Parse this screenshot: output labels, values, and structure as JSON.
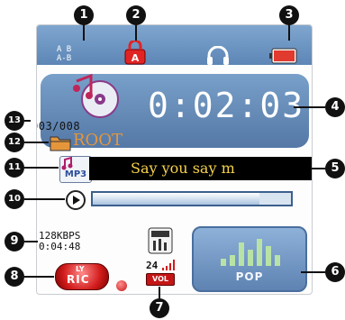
{
  "status_bar": {
    "ab_top": "A B",
    "ab_bottom": "A-B",
    "lock_label": "A"
  },
  "track": {
    "counter": "003/008",
    "folder": "ROOT",
    "lyric": "Say you say m",
    "format": "MP3"
  },
  "time": {
    "elapsed": "0:02:03"
  },
  "audio": {
    "bitrate": "128KBPS",
    "total": "0:04:48",
    "eq": "POP",
    "vol": "24",
    "vol_label": "VOL",
    "lyric_label_top": "LY",
    "lyric_label_bottom": "RIC"
  },
  "progress": {
    "fraction": 0.84
  },
  "callouts": [
    "1",
    "2",
    "3",
    "4",
    "5",
    "6",
    "7",
    "8",
    "9",
    "10",
    "11",
    "12",
    "13"
  ],
  "colors": {
    "panel": "#6b92c0",
    "lyric_text": "#f7d34c",
    "folder_text": "#e5963b",
    "battery": "#e13a2e"
  }
}
